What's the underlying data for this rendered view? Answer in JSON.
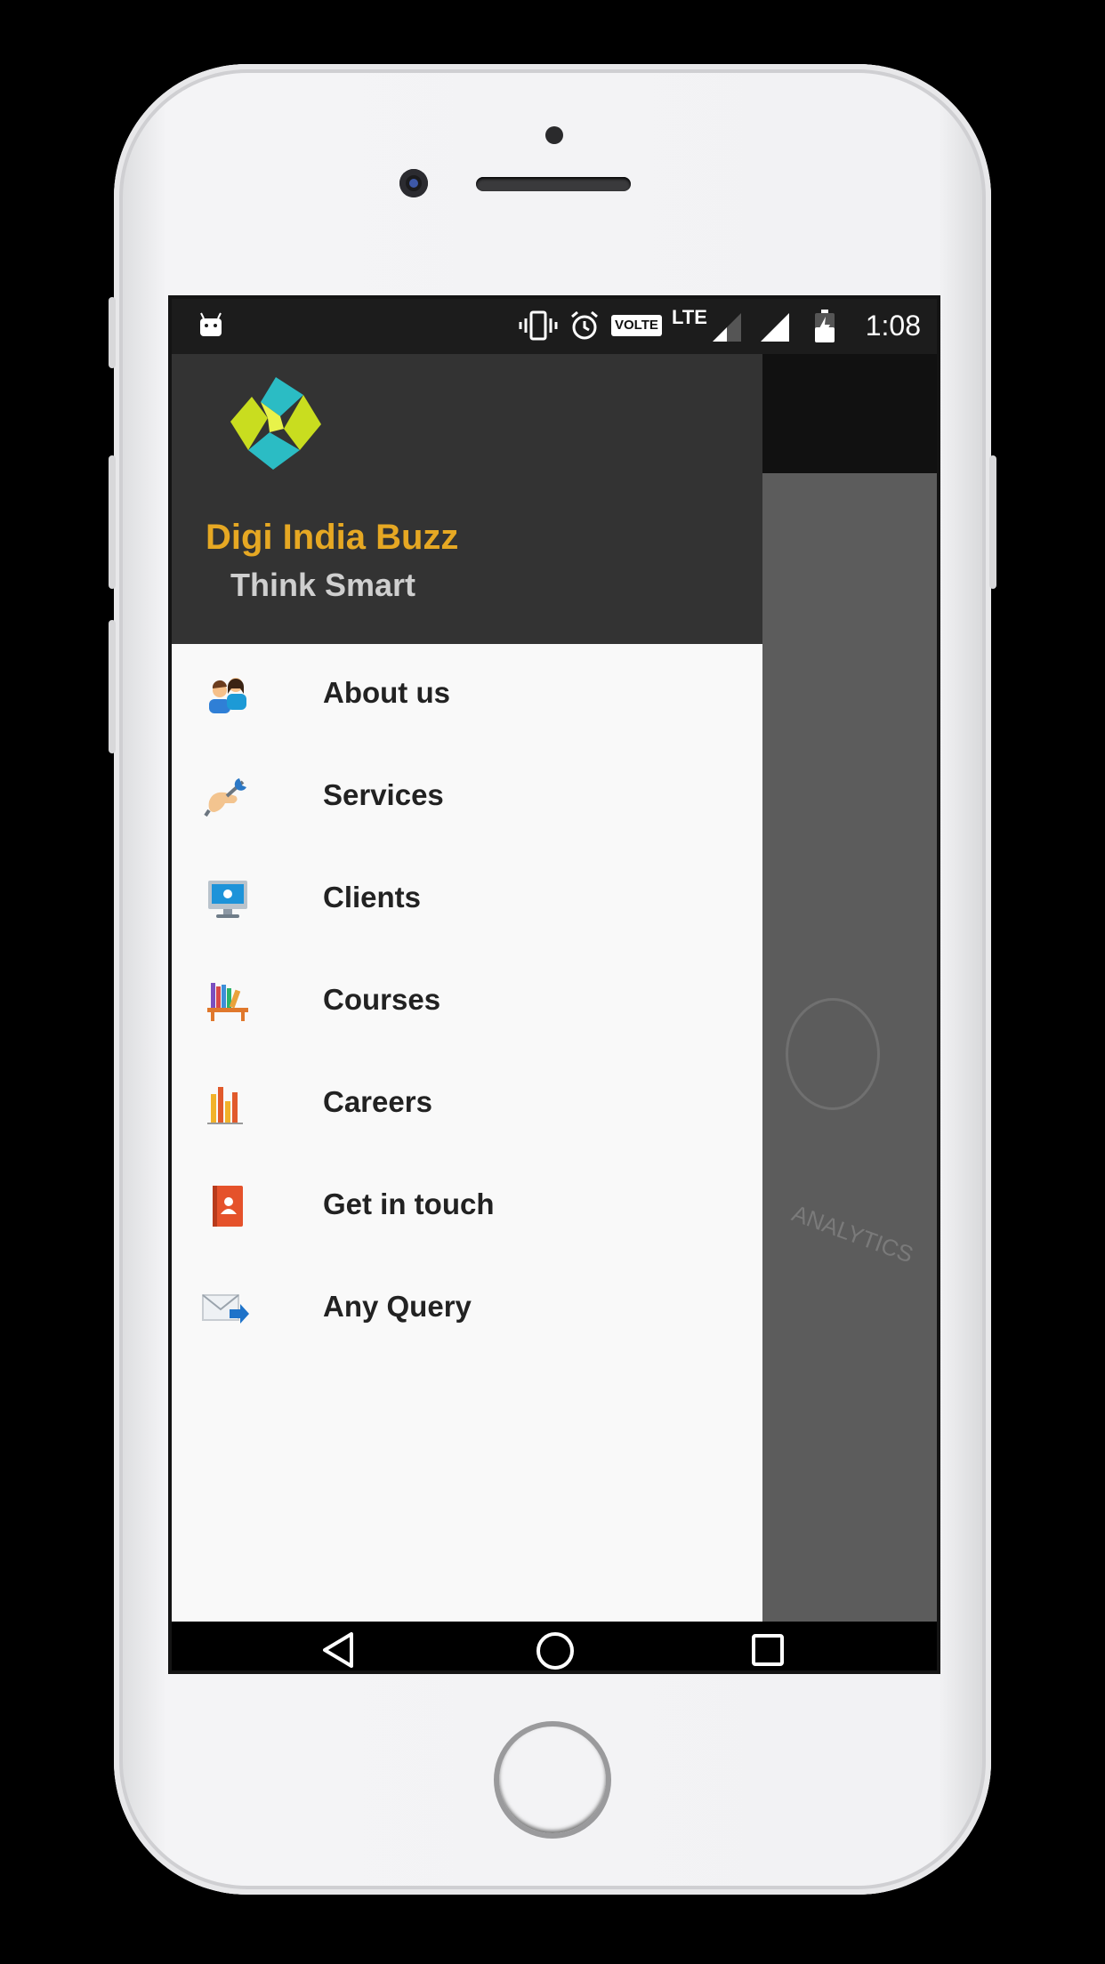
{
  "status_bar": {
    "time": "1:08",
    "network_label": "LTE",
    "volte_label": "VOLTE",
    "icons": [
      "android-notification-icon",
      "vibrate-icon",
      "alarm-icon",
      "volte-icon",
      "lte-icon",
      "signal-icon",
      "signal-full-icon",
      "battery-charging-icon"
    ]
  },
  "drawer": {
    "brand": "Digi India Buzz",
    "tagline": "Think Smart",
    "items": [
      {
        "label": "About us",
        "icon": "people-icon"
      },
      {
        "label": "Services",
        "icon": "wrench-hand-icon"
      },
      {
        "label": "Clients",
        "icon": "monitor-icon"
      },
      {
        "label": "Courses",
        "icon": "bookshelf-icon"
      },
      {
        "label": "Careers",
        "icon": "bar-chart-icon"
      },
      {
        "label": "Get in touch",
        "icon": "contact-book-icon"
      },
      {
        "label": "Any Query",
        "icon": "mail-forward-icon"
      }
    ]
  },
  "background_content": {
    "art_text": "ANALYTICS"
  },
  "navigation": [
    "back-icon",
    "home-icon",
    "recents-icon"
  ],
  "colors": {
    "header_bg": "#333333",
    "brand": "#e6a823",
    "tagline": "#cfcfcf",
    "drawer_bg": "#f9f9f9"
  }
}
